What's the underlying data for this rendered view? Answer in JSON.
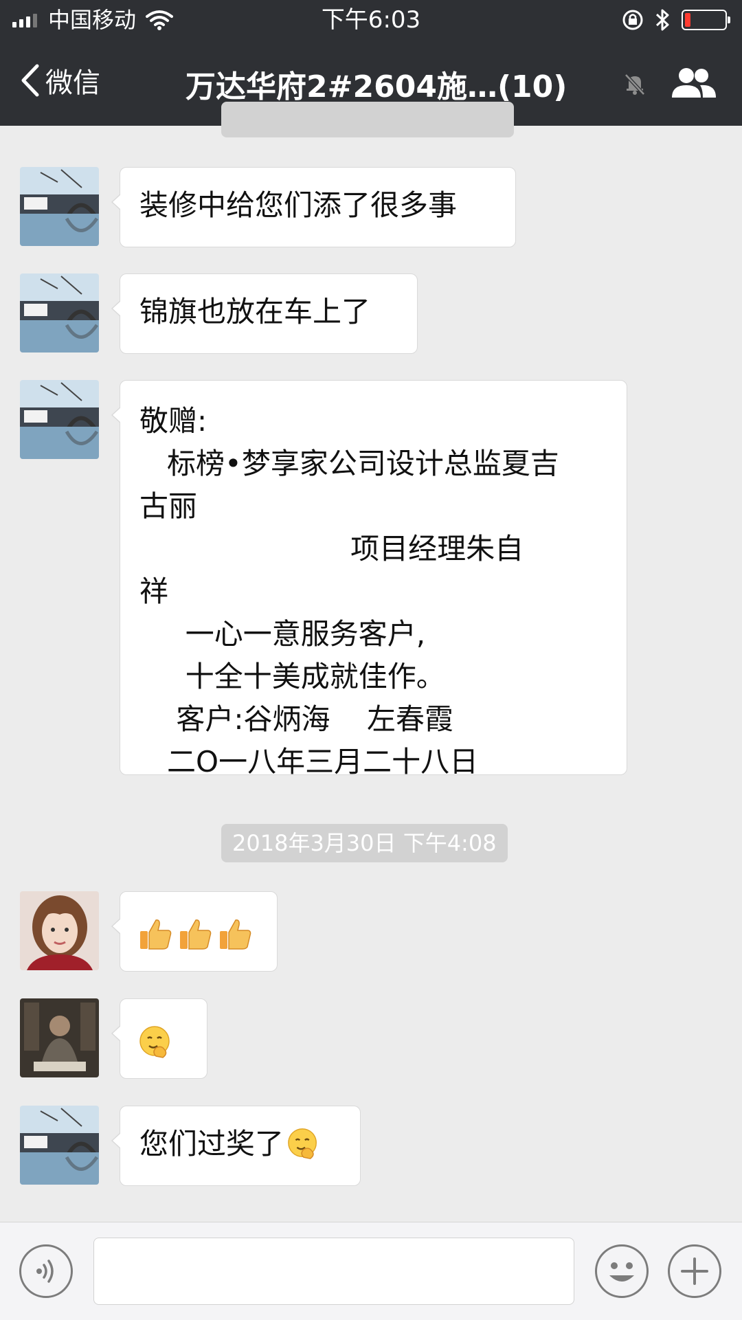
{
  "status_bar": {
    "carrier": "中国移动",
    "time": "下午6:03"
  },
  "nav": {
    "back_label": "微信",
    "title": "万达华府2#2604施…(10)"
  },
  "messages": [
    {
      "id": "m1",
      "text": "装修中给您们添了很多事"
    },
    {
      "id": "m2",
      "text": "锦旗也放在车上了"
    },
    {
      "id": "m3",
      "lines": [
        "敬赠:",
        "   标榜•梦享家公司设计总监夏吉",
        "古丽",
        "                       项目经理朱自",
        "祥",
        "     一心一意服务客户,",
        "     十全十美成就佳作。",
        "    客户:谷炳海    左春霞",
        "   二O一八年三月二十八日"
      ]
    },
    {
      "id": "m4",
      "emoji": [
        "thumbs-up",
        "thumbs-up",
        "thumbs-up"
      ]
    },
    {
      "id": "m5",
      "emoji": [
        "shy-smile"
      ]
    },
    {
      "id": "m6",
      "text": "您们过奖了",
      "emoji": [
        "shy-smile"
      ]
    }
  ],
  "timestamp": "2018年3月30日 下午4:08",
  "input": {
    "value": ""
  }
}
